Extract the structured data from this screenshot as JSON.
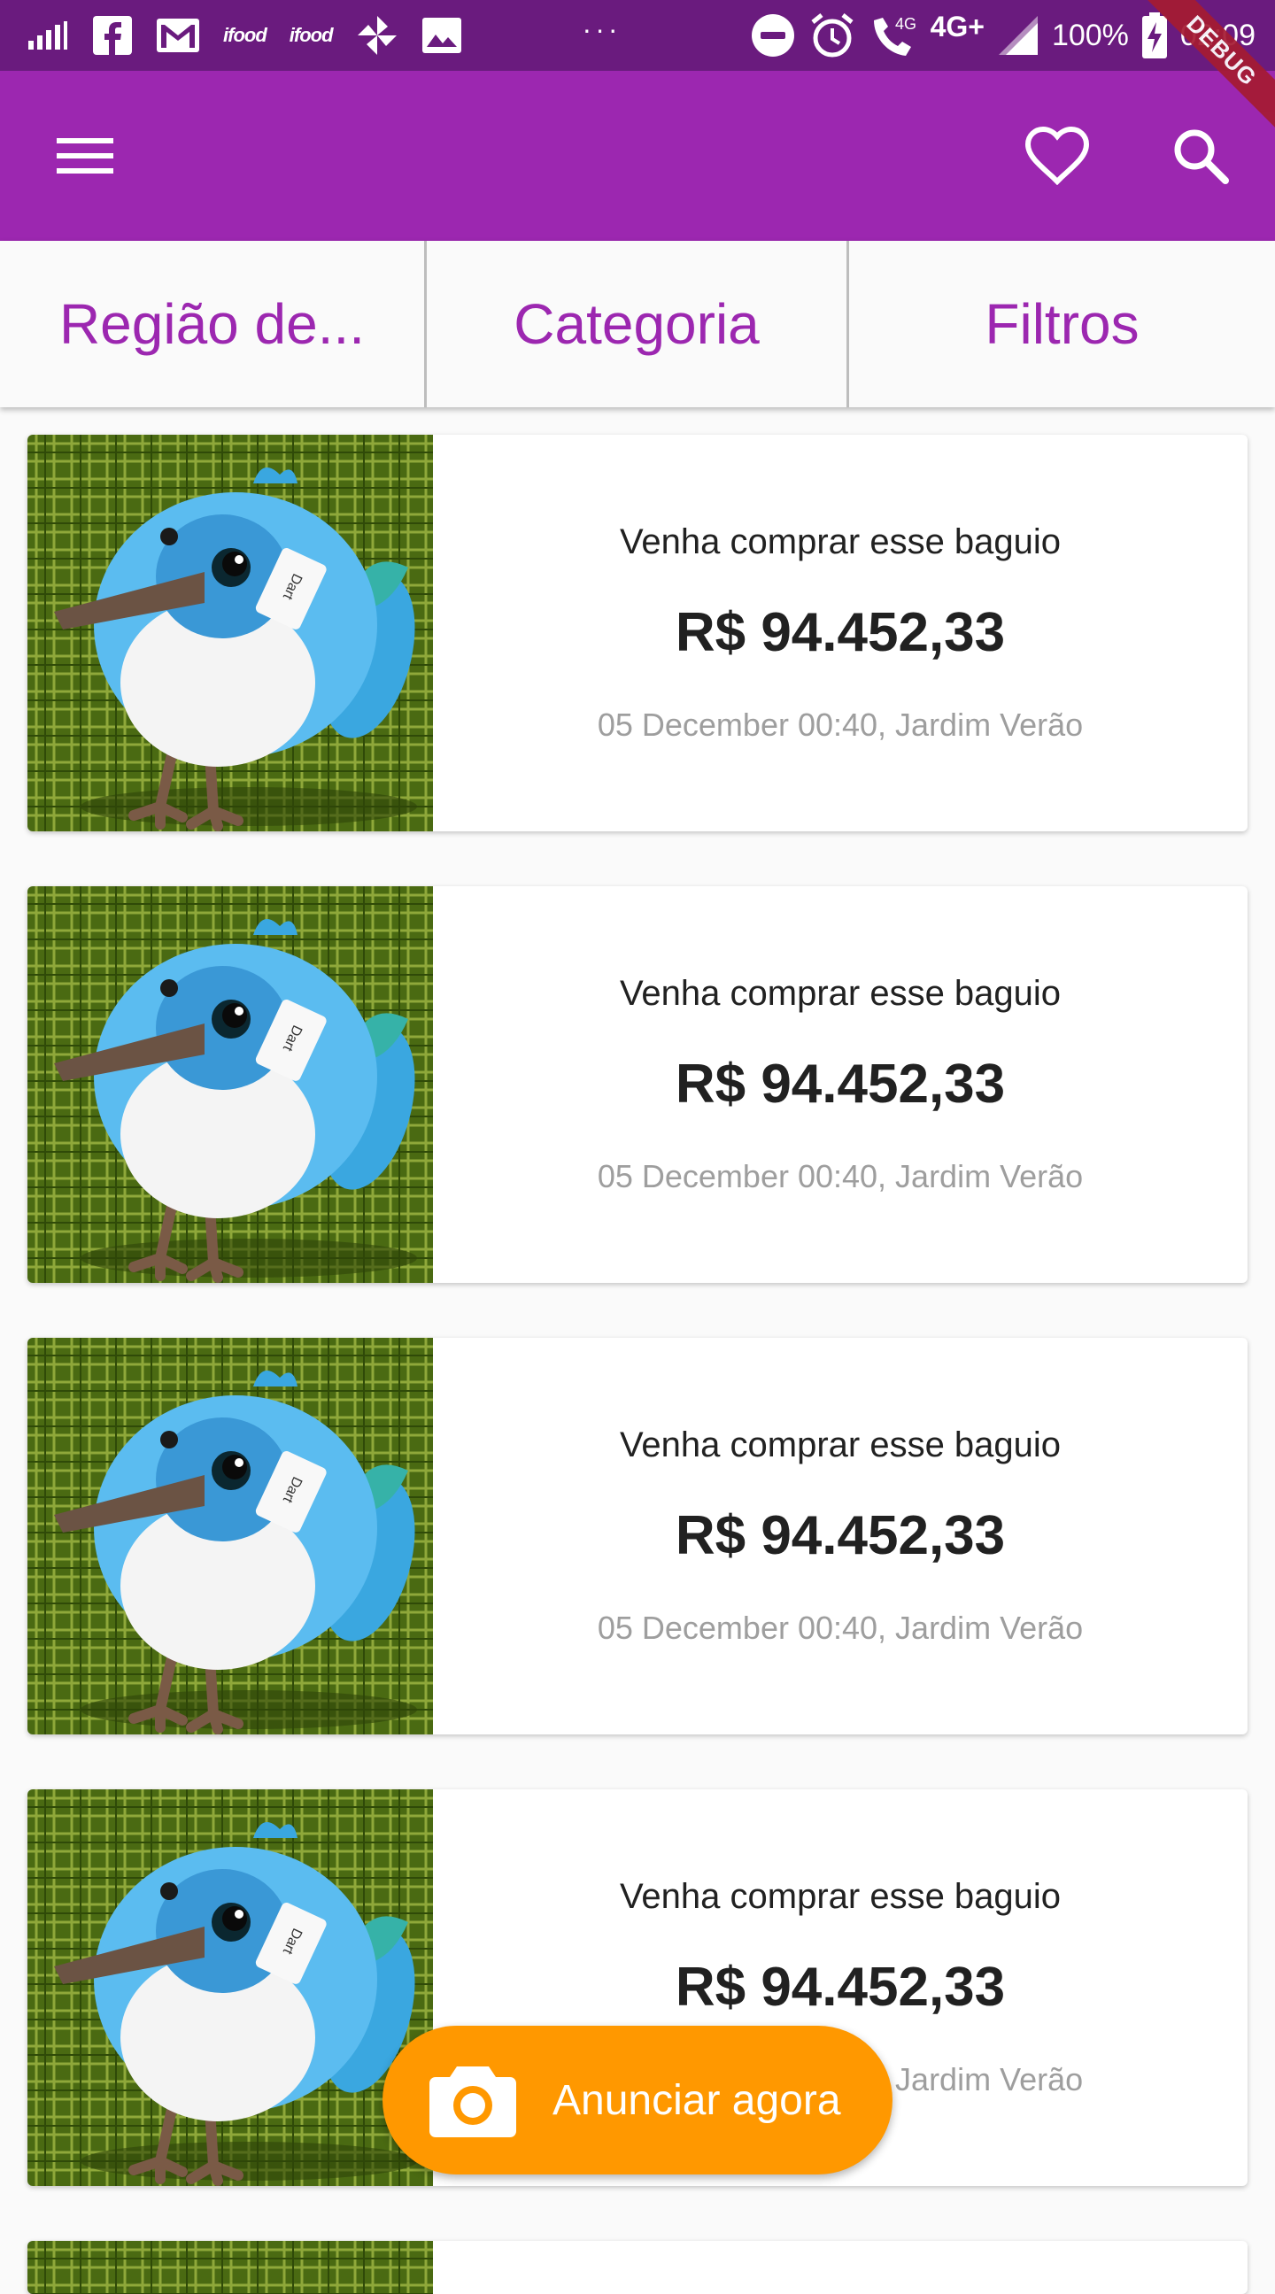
{
  "status_bar": {
    "left_icons": [
      "signal-bars-icon",
      "facebook-icon",
      "gmail-icon",
      "ifood-icon",
      "ifood-icon",
      "pinwheel-icon",
      "image-icon"
    ],
    "ifood_label": "ifood",
    "overflow": "···",
    "right_icons": [
      "do-not-disturb-icon",
      "alarm-icon",
      "wifi-calling-icon",
      "cell-signal-icon",
      "battery-charging-icon"
    ],
    "call_label": "4G",
    "network": "4G+",
    "battery": "100%",
    "time": "02:09"
  },
  "debug_banner": "DEBUG",
  "app_bar": {
    "color": "#9c27b0",
    "menu_icon": "menu-icon",
    "favorite_icon": "heart-outline-icon",
    "search_icon": "search-icon"
  },
  "filters": {
    "region": "Região de...",
    "category": "Categoria",
    "filters": "Filtros"
  },
  "listings": [
    {
      "title": "Venha comprar esse baguio",
      "price": "R$ 94.452,33",
      "meta": "05 December 00:40, Jardim Verão"
    },
    {
      "title": "Venha comprar esse baguio",
      "price": "R$ 94.452,33",
      "meta": "05 December 00:40, Jardim Verão"
    },
    {
      "title": "Venha comprar esse baguio",
      "price": "R$ 94.452,33",
      "meta": "05 December 00:40, Jardim Verão"
    },
    {
      "title": "Venha comprar esse baguio",
      "price": "R$ 94.452,33",
      "meta": "05 December 00:40, Jardim Verão"
    }
  ],
  "fab": {
    "label": "Anunciar agora",
    "icon": "camera-icon",
    "color": "#ff9800"
  }
}
